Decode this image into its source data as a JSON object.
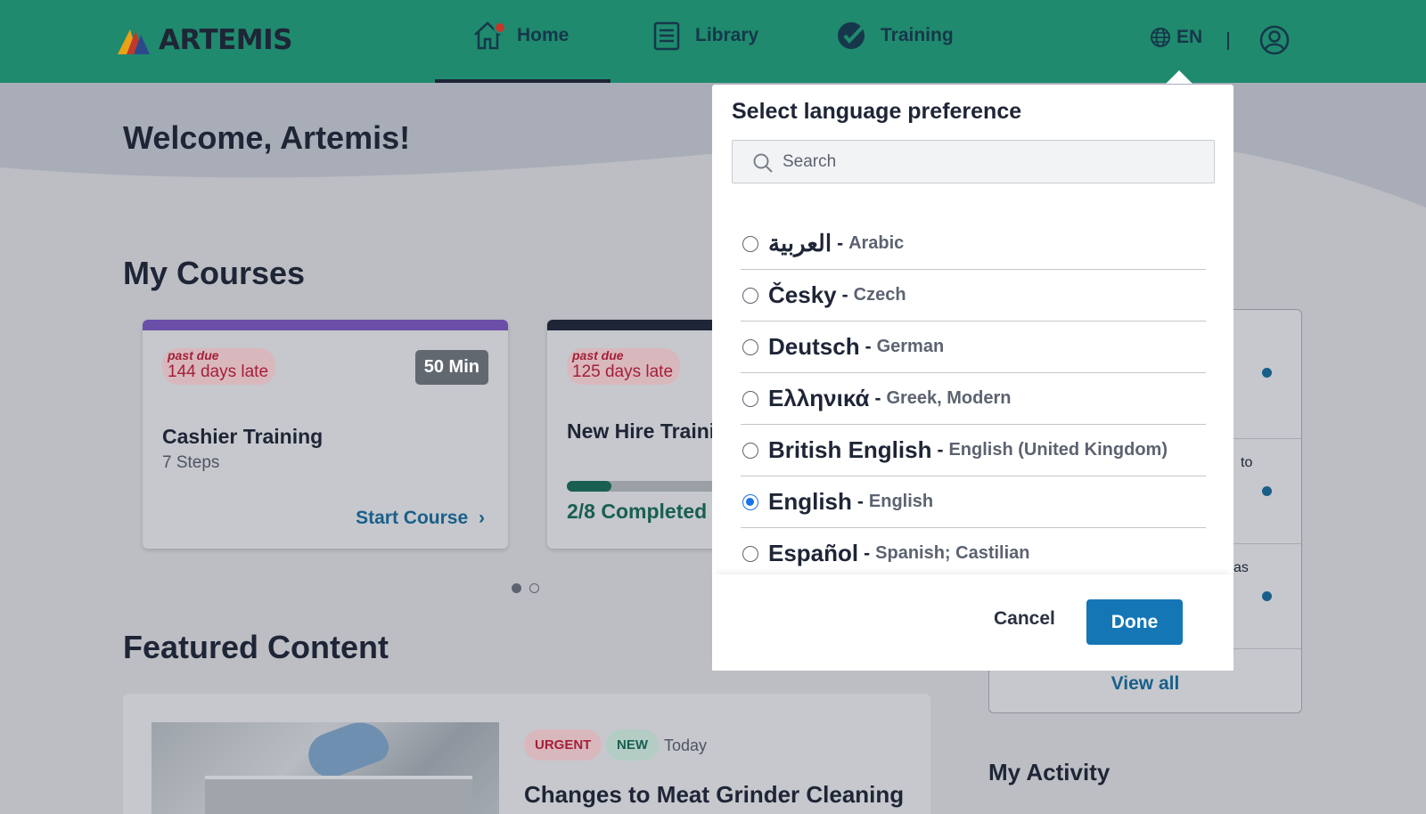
{
  "app": {
    "brand": "ARTEMIS"
  },
  "nav": {
    "items": [
      {
        "label": "Home",
        "icon": "home-icon"
      },
      {
        "label": "Library",
        "icon": "library-icon"
      },
      {
        "label": "Training",
        "icon": "training-check-icon"
      }
    ],
    "active": "Home",
    "language": "EN",
    "globe_icon": "globe-icon",
    "user_icon": "user-account-icon"
  },
  "welcome": "Welcome, Artemis!",
  "sections": {
    "my_courses": "My Courses",
    "featured": "Featured Content",
    "my_activity": "My Activity"
  },
  "courses": [
    {
      "status_small": "past due",
      "status": "144 days late",
      "duration": "50 Min",
      "title": "Cashier Training",
      "steps": "7 Steps",
      "action": "Start Course",
      "bar_color": "#6b4ea8"
    },
    {
      "status_small": "past due",
      "status": "125 days late",
      "title": "New Hire Trainir",
      "progress": 0.25,
      "progress_text": "2/8 Completed",
      "bar_color": "#1e2536"
    }
  ],
  "carousel": {
    "pages": 2,
    "active": 0
  },
  "featured_item": {
    "tags": [
      "URGENT",
      "NEW"
    ],
    "date": "Today",
    "title": "Changes to Meat Grinder Cleaning"
  },
  "right_panel": {
    "fragments": [
      "to",
      "as"
    ],
    "view_all": "View all",
    "accent": "#1a5f8a"
  },
  "language_modal": {
    "title": "Select language preference",
    "search_placeholder": "Search",
    "languages": [
      {
        "native": "العربية",
        "english": "Arabic",
        "selected": false
      },
      {
        "native": "Česky",
        "english": "Czech",
        "selected": false
      },
      {
        "native": "Deutsch",
        "english": "German",
        "selected": false
      },
      {
        "native": "Ελληνικά",
        "english": "Greek, Modern",
        "selected": false
      },
      {
        "native": "British English",
        "english": "English (United Kingdom)",
        "selected": false
      },
      {
        "native": "English",
        "english": "English",
        "selected": true
      },
      {
        "native": "Español",
        "english": "Spanish; Castilian",
        "selected": false
      }
    ],
    "cancel": "Cancel",
    "done": "Done"
  },
  "colors": {
    "header": "#1f8a6e",
    "primary_button": "#1576b6",
    "danger": "#a3203a",
    "success": "#195f51"
  }
}
